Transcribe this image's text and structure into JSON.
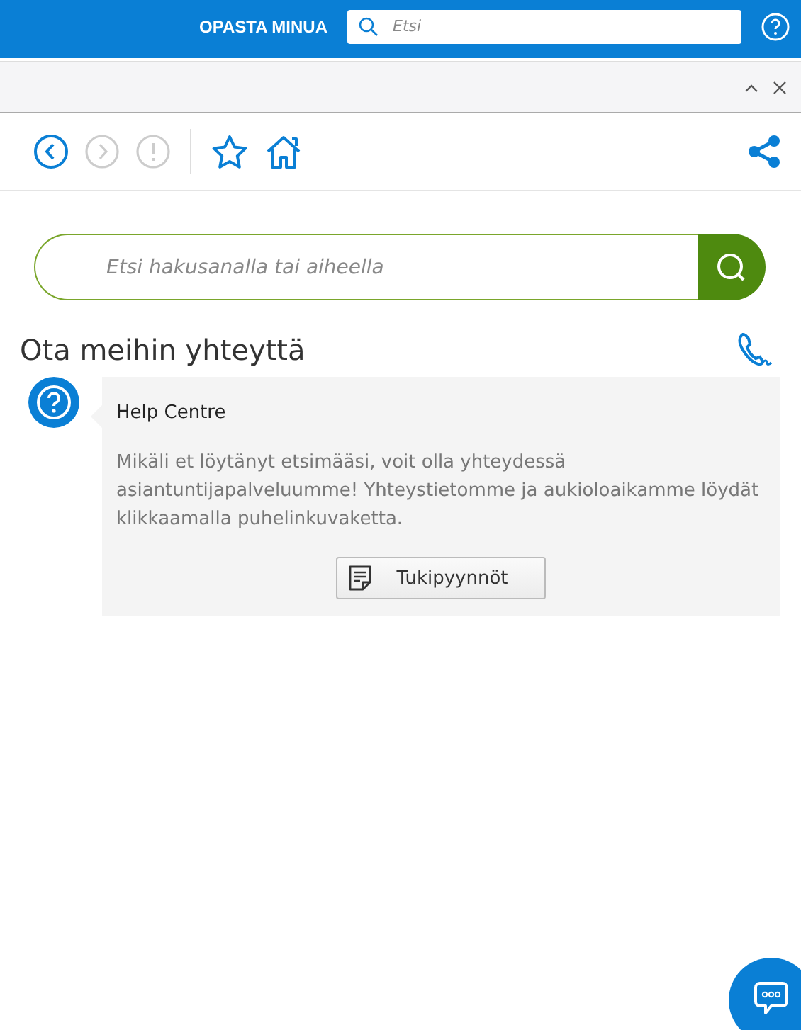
{
  "top_bar": {
    "guide_link": "OPASTA MINUA",
    "search": {
      "placeholder": "Etsi"
    }
  },
  "toolbar": {
    "nav": [
      {
        "kind": "back",
        "disabled": false
      },
      {
        "kind": "forward",
        "disabled": true
      },
      {
        "kind": "alert",
        "disabled": true
      }
    ]
  },
  "search": {
    "placeholder": "Etsi hakusanalla tai aiheella"
  },
  "section": {
    "title": "Ota meihin yhteyttä"
  },
  "message": {
    "sender": "Help Centre",
    "text": "Mikäli et löytänyt etsimääsi, voit olla yhteydessä asiantuntijapalveluumme! Yhteystietomme ja aukioloaikamme löydät klikkaamalla puhelinkuvaketta.",
    "button": "Tukipyynnöt"
  }
}
